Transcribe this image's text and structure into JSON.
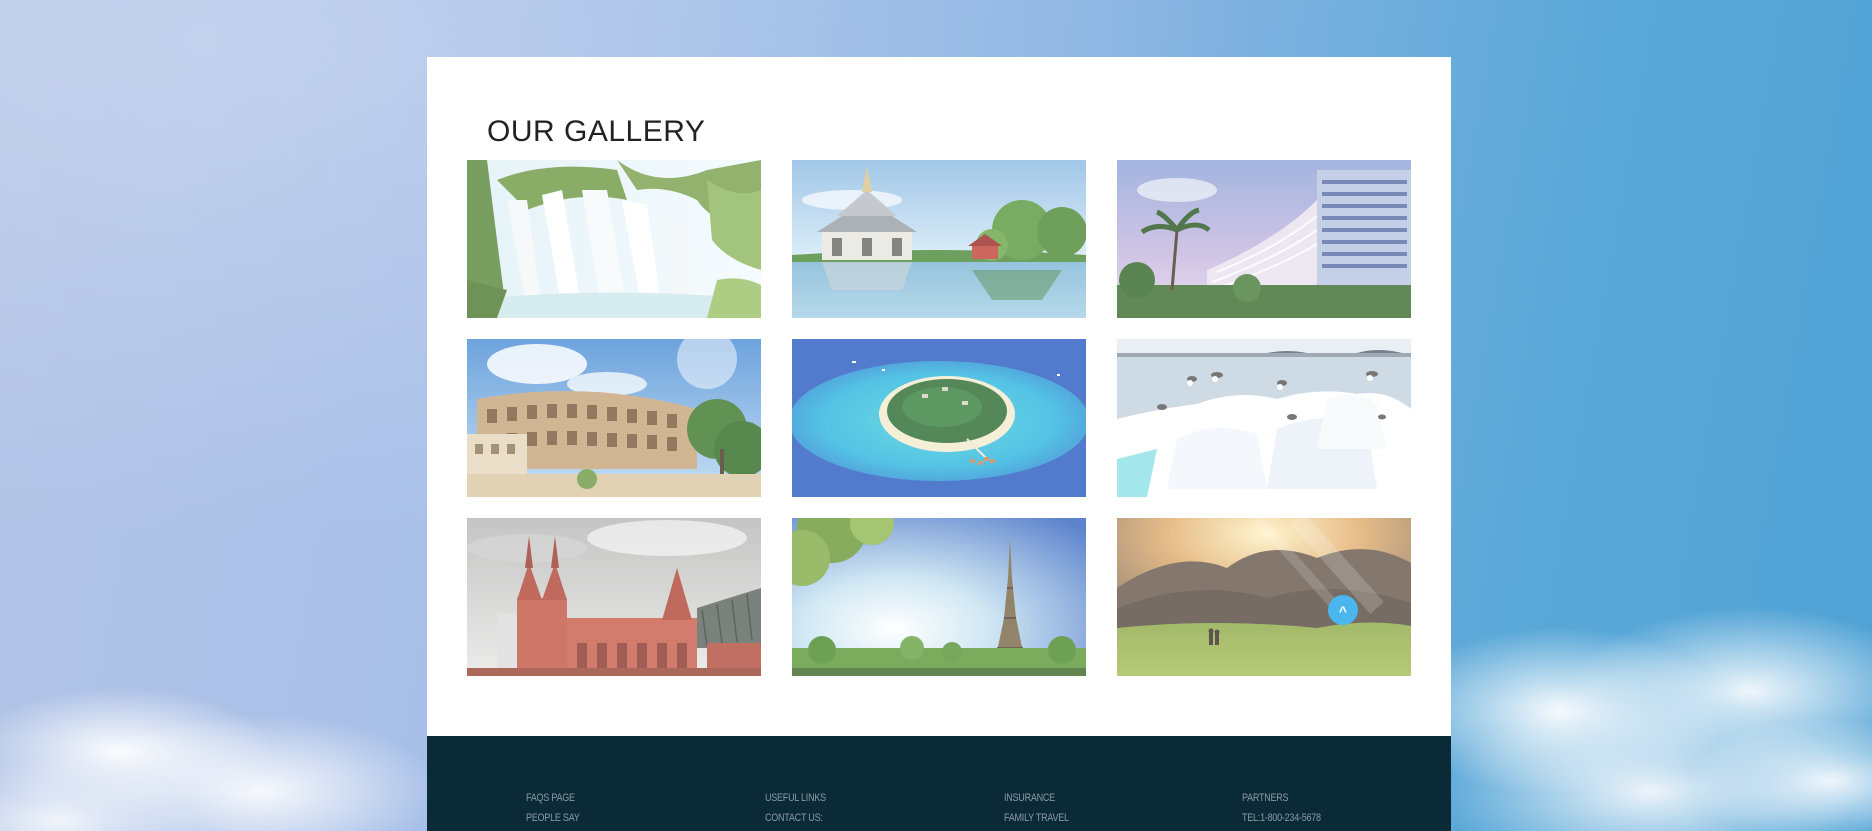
{
  "gallery": {
    "title": "OUR GALLERY",
    "images": [
      {
        "name": "waterfall"
      },
      {
        "name": "thai-temple"
      },
      {
        "name": "resort-hotel"
      },
      {
        "name": "colosseum"
      },
      {
        "name": "tropical-island"
      },
      {
        "name": "icebergs-seagulls"
      },
      {
        "name": "red-castle-bridge"
      },
      {
        "name": "eiffel-tower"
      },
      {
        "name": "mountain-valley"
      }
    ]
  },
  "scroll_top": {
    "label": "^"
  },
  "footer": {
    "columns": [
      {
        "items": [
          "FAQS PAGE",
          "PEOPLE SAY"
        ]
      },
      {
        "items": [
          "USEFUL LINKS",
          "CONTACT US:"
        ]
      },
      {
        "items": [
          "INSURANCE",
          "FAMILY TRAVEL"
        ]
      },
      {
        "items": [
          "PARTNERS",
          "TEL:1-800-234-5678"
        ]
      }
    ]
  },
  "colors": {
    "panel": "#ffffff",
    "footer_bg": "#0a2a37",
    "footer_text": "#8a9aa4",
    "accent": "#49b6ee"
  }
}
